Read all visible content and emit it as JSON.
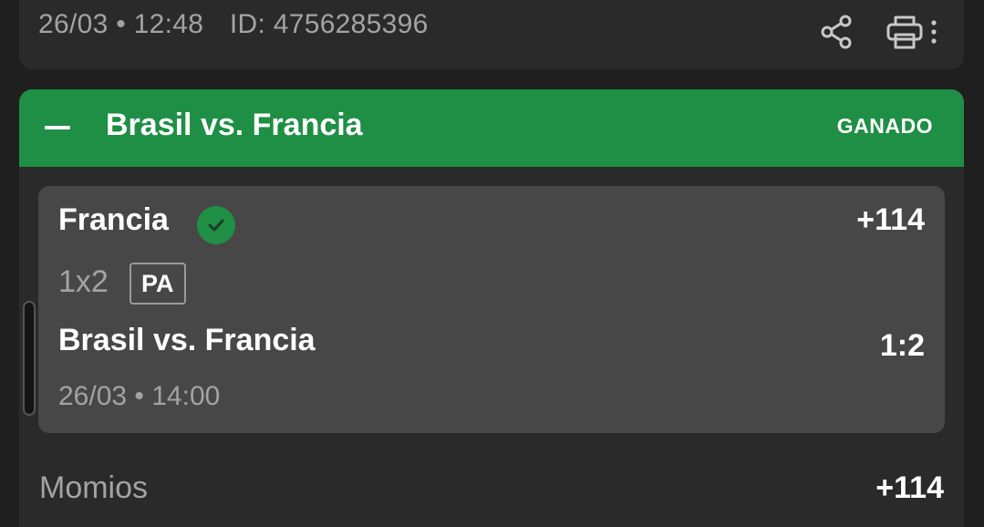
{
  "header": {
    "date_time": "26/03 • 12:48",
    "id_text": "ID: 4756285396",
    "icons": [
      "share-icon",
      "print-icon",
      "more-vertical-icon"
    ]
  },
  "bet": {
    "title": "Brasil vs. Francia",
    "status": "GANADO",
    "status_color": "#1e8f44",
    "selection": {
      "team": "Francia",
      "odds": "+114",
      "market": "1x2",
      "badge": "PA",
      "event": "Brasil vs. Francia",
      "score": "1:2",
      "event_datetime": "26/03 • 14:00"
    },
    "odds_row": {
      "label": "Momios",
      "value": "+114"
    }
  }
}
